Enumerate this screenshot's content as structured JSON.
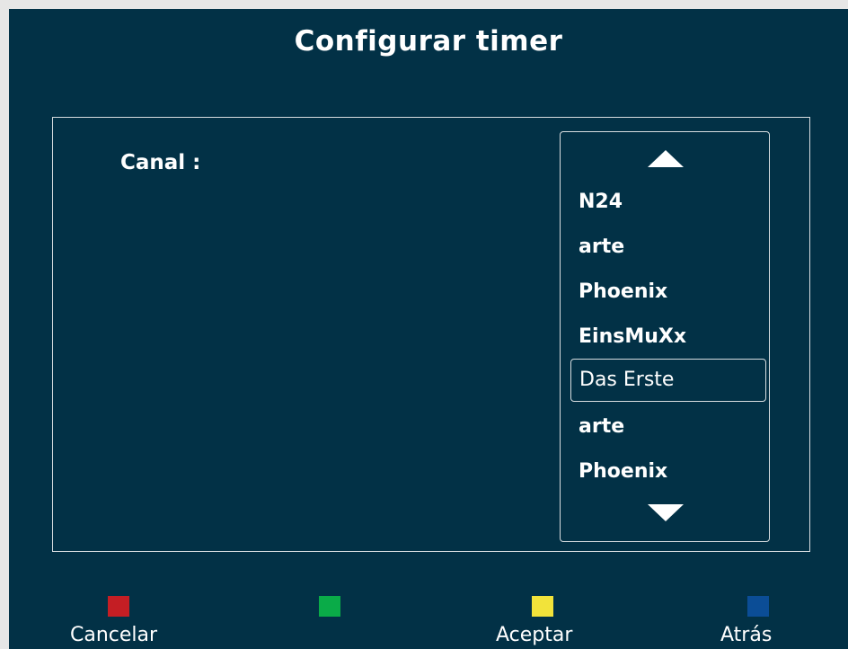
{
  "screen": {
    "title": "Configurar timer"
  },
  "form": {
    "canal_label": "Canal :"
  },
  "channel_list": {
    "items": [
      {
        "label": "N24",
        "selected": false
      },
      {
        "label": "arte",
        "selected": false
      },
      {
        "label": "Phoenix",
        "selected": false
      },
      {
        "label": "EinsMuXx",
        "selected": false
      },
      {
        "label": "Das Erste",
        "selected": true
      },
      {
        "label": "arte",
        "selected": false
      },
      {
        "label": "Phoenix",
        "selected": false
      }
    ],
    "scroll_up_icon": "triangle-up",
    "scroll_down_icon": "triangle-down"
  },
  "footer": {
    "keys": [
      {
        "color": "red",
        "hex": "#c41e24",
        "label": "Cancelar"
      },
      {
        "color": "green",
        "hex": "#0aab48",
        "label": ""
      },
      {
        "color": "yellow",
        "hex": "#f2e33a",
        "label": "Aceptar"
      },
      {
        "color": "blue",
        "hex": "#0b4d96",
        "label": "Atrás"
      }
    ]
  },
  "colors": {
    "background": "#023146",
    "foreground": "#ffffff",
    "border": "#d8dde0"
  }
}
